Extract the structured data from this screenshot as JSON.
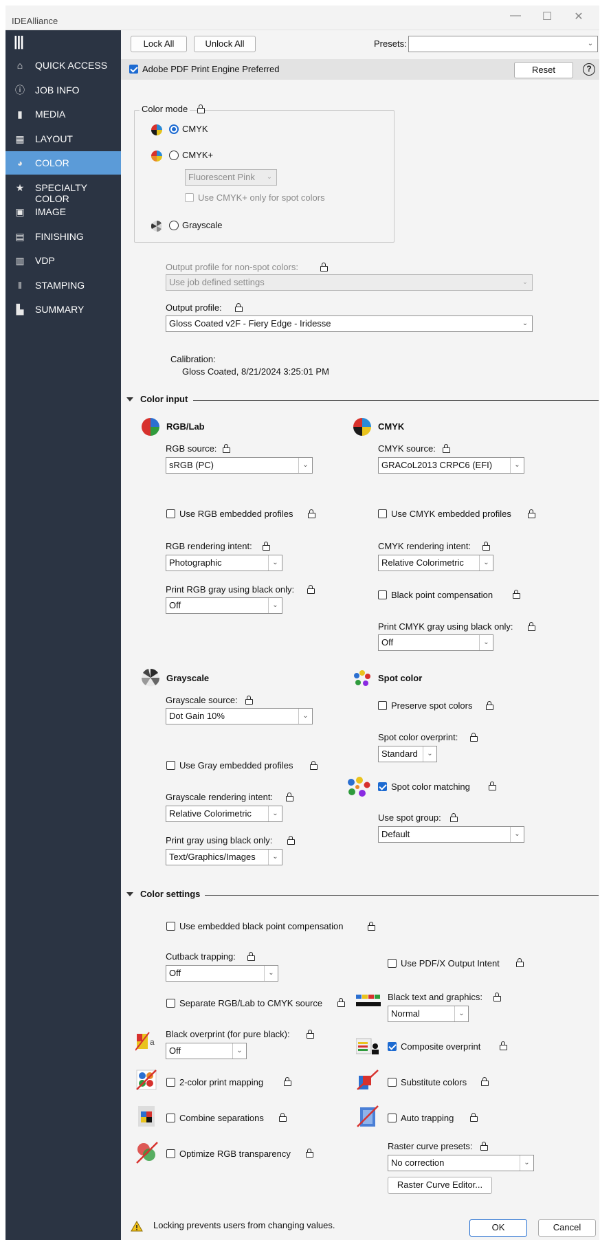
{
  "window": {
    "title": "IDEAlliance",
    "minimize": "—",
    "maximize": "☐",
    "close": "✕"
  },
  "sidebar": {
    "menu_icon": "|||",
    "items": [
      {
        "label": "QUICK ACCESS",
        "icon": "home-icon"
      },
      {
        "label": "JOB INFO",
        "icon": "info-icon"
      },
      {
        "label": "MEDIA",
        "icon": "media-icon"
      },
      {
        "label": "LAYOUT",
        "icon": "layout-icon"
      },
      {
        "label": "COLOR",
        "icon": "palette-icon",
        "active": true
      },
      {
        "label": "SPECIALTY COLOR",
        "icon": "star-icon"
      },
      {
        "label": "IMAGE",
        "icon": "image-icon"
      },
      {
        "label": "FINISHING",
        "icon": "finishing-icon"
      },
      {
        "label": "VDP",
        "icon": "vdp-icon"
      },
      {
        "label": "STAMPING",
        "icon": "stamping-icon"
      },
      {
        "label": "SUMMARY",
        "icon": "summary-icon"
      }
    ]
  },
  "toolbar": {
    "lock_all": "Lock All",
    "unlock_all": "Unlock All",
    "presets_label": "Presets:",
    "presets_value": ""
  },
  "engine": {
    "label": "Adobe PDF Print Engine Preferred",
    "checked": true,
    "reset": "Reset",
    "help": "?"
  },
  "color_mode": {
    "legend": "Color mode",
    "cmyk": "CMYK",
    "cmyk_plus": "CMYK+",
    "fluorescent": "Fluorescent Pink",
    "cmyk_plus_spot": "Use CMYK+ only for spot colors",
    "grayscale": "Grayscale",
    "selected": "CMYK"
  },
  "output": {
    "nonspot_label": "Output profile for non-spot colors:",
    "nonspot_value": "Use job defined settings",
    "profile_label": "Output profile:",
    "profile_value": "Gloss Coated v2F - Fiery Edge - Iridesse",
    "calibration_label": "Calibration:",
    "calibration_value": "Gloss Coated, 8/21/2024 3:25:01 PM"
  },
  "color_input": {
    "title": "Color input",
    "rgb": {
      "title": "RGB/Lab",
      "source_label": "RGB source:",
      "source_value": "sRGB (PC)",
      "embedded": "Use RGB embedded profiles",
      "intent_label": "RGB rendering intent:",
      "intent_value": "Photographic",
      "gray_label": "Print RGB gray using black only:",
      "gray_value": "Off"
    },
    "cmyk": {
      "title": "CMYK",
      "source_label": "CMYK source:",
      "source_value": "GRACoL2013 CRPC6 (EFI)",
      "embedded": "Use CMYK embedded profiles",
      "intent_label": "CMYK rendering intent:",
      "intent_value": "Relative Colorimetric",
      "bpc": "Black point compensation",
      "gray_label": "Print CMYK gray using black only:",
      "gray_value": "Off"
    },
    "gray": {
      "title": "Grayscale",
      "source_label": "Grayscale source:",
      "source_value": "Dot Gain 10%",
      "embedded": "Use Gray embedded profiles",
      "intent_label": "Grayscale rendering intent:",
      "intent_value": "Relative Colorimetric",
      "black_label": "Print gray using black only:",
      "black_value": "Text/Graphics/Images"
    },
    "spot": {
      "title": "Spot color",
      "preserve": "Preserve spot colors",
      "overprint_label": "Spot color overprint:",
      "overprint_value": "Standard",
      "matching": "Spot color matching",
      "matching_checked": true,
      "group_label": "Use spot group:",
      "group_value": "Default"
    }
  },
  "color_settings": {
    "title": "Color settings",
    "embedded_bpc": "Use embedded black point compensation",
    "cutback_label": "Cutback trapping:",
    "cutback_value": "Off",
    "pdfx": "Use PDF/X Output Intent",
    "separate": "Separate RGB/Lab to CMYK source",
    "black_text_label": "Black text and graphics:",
    "black_text_value": "Normal",
    "black_overprint_label": "Black overprint (for pure black):",
    "black_overprint_value": "Off",
    "composite": "Composite overprint",
    "composite_checked": true,
    "two_color": "2-color print mapping",
    "substitute": "Substitute colors",
    "combine": "Combine separations",
    "auto_trap": "Auto trapping",
    "optimize": "Optimize RGB transparency",
    "raster_label": "Raster curve presets:",
    "raster_value": "No correction",
    "raster_editor": "Raster Curve Editor..."
  },
  "footer": {
    "note": "Locking prevents users from changing values.",
    "ok": "OK",
    "cancel": "Cancel"
  }
}
